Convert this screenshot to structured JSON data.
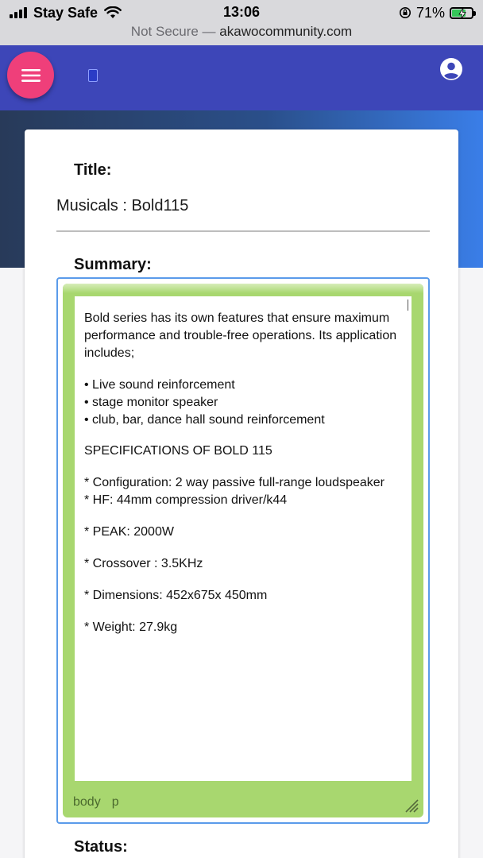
{
  "statusbar": {
    "carrier": "Stay Safe",
    "time": "13:06",
    "battery": "71%",
    "battery_level": 0.71,
    "url_prefix": "Not Secure —",
    "url_domain": "akawocommunity.com"
  },
  "header": {
    "menu_icon": "hamburger-icon",
    "account_icon": "account-circle-icon"
  },
  "form": {
    "title_label": "Title:",
    "title_value": "Musicals : Bold115",
    "summary_label": "Summary:",
    "status_label": "Status:",
    "summary": {
      "intro": "Bold series has its own features that ensure maximum performance and trouble-free operations. Its application includes;",
      "bullets": [
        "• Live sound reinforcement",
        "• stage monitor speaker",
        "• club, bar, dance hall sound reinforcement"
      ],
      "spec_heading": "SPECIFICATIONS OF BOLD 115",
      "spec_config": "* Configuration: 2 way passive full-range loudspeaker",
      "spec_hf": "* HF: 44mm compression driver/k44",
      "spec_peak": "* PEAK: 2000W",
      "spec_crossover": "* Crossover : 3.5KHz",
      "spec_dimensions": "* Dimensions: 452x675x 450mm",
      "spec_weight": "* Weight: 27.9kg"
    },
    "editor_path": [
      "body",
      "p"
    ]
  },
  "colors": {
    "header_bg": "#3d46b8",
    "menu_button": "#ef3f7a",
    "editor_frame": "#a8d76f",
    "editor_focus_border": "#5a9bea"
  }
}
